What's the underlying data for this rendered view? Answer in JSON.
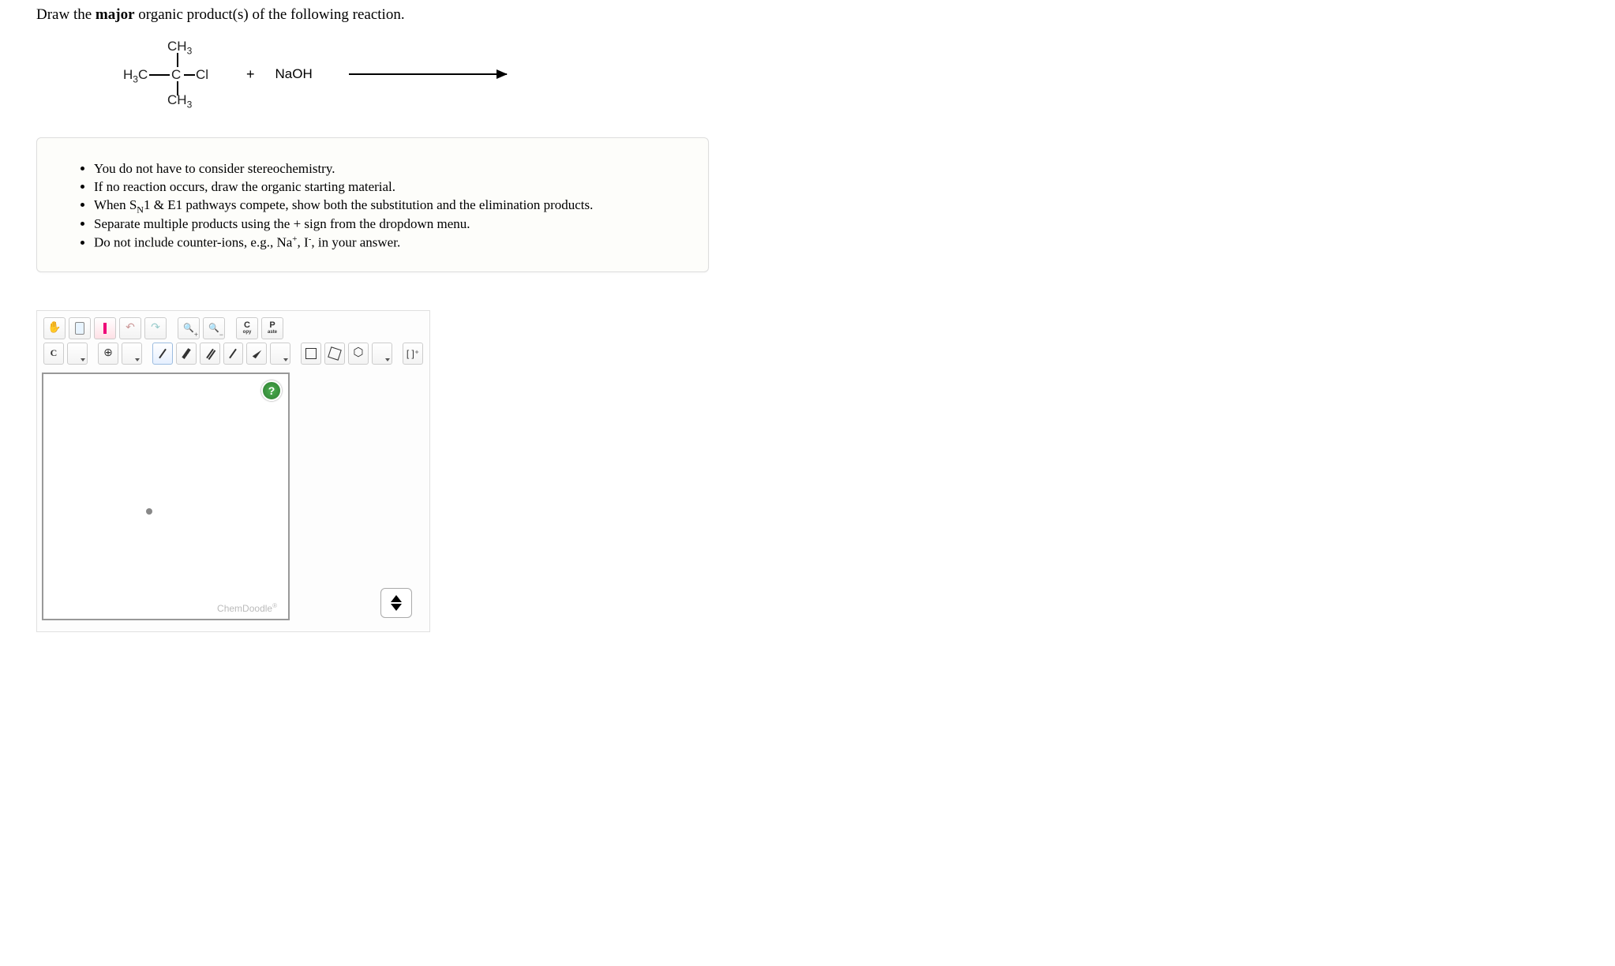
{
  "question": {
    "prefix": "Draw the ",
    "bold": "major",
    "suffix": " organic product(s) of the following reaction."
  },
  "reaction": {
    "structure": {
      "top": "CH",
      "top_sub": "3",
      "left": "H",
      "left_sub": "3",
      "left2": "C",
      "center": "C",
      "right": "Cl",
      "bottom": "CH",
      "bottom_sub": "3"
    },
    "plus": "+",
    "reagent": "NaOH"
  },
  "instructions": [
    "You do not have to consider stereochemistry.",
    "If no reaction occurs, draw the organic starting material.",
    "When S_N1 & E1 pathways compete, show both the substitution and the elimination products.",
    "Separate multiple products using the + sign from the dropdown menu.",
    "Do not include counter-ions, e.g., Na⁺, I⁻, in your answer."
  ],
  "toolbar1": {
    "copy_top": "C",
    "copy_bot": "opy",
    "paste_top": "P",
    "paste_bot": "aste"
  },
  "toolbar2": {
    "element": "C",
    "bracket": "[ ]⁺"
  },
  "help": "?",
  "brand": "ChemDoodle",
  "brand_mark": "®"
}
